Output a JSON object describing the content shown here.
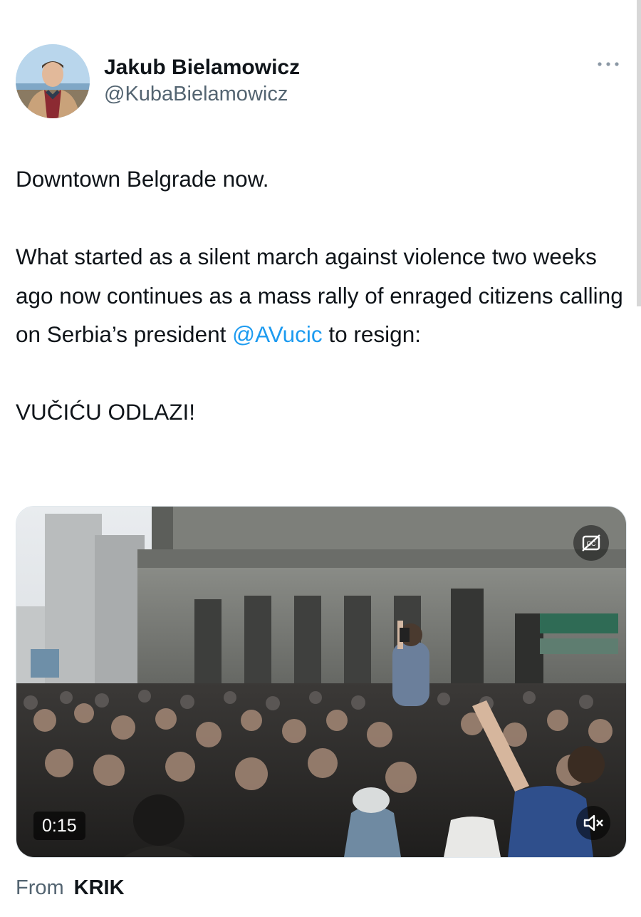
{
  "author": {
    "display_name": "Jakub Bielamowicz",
    "handle": "@KubaBielamowicz",
    "avatar_icon": "person-photo-avatar"
  },
  "more_menu": {
    "icon": "more-horizontal-icon"
  },
  "tweet": {
    "line1": "Downtown Belgrade now.",
    "line2": "What started as a silent march against violence two weeks ago now continues as a mass rally of enraged citizens calling on Serbia’s president ",
    "mention": "@AVucic",
    "line2_end": " to resign:",
    "line3": "VUČIĆU ODLAZI!",
    "mention_color": "#1d9bf0"
  },
  "video": {
    "duration": "0:15",
    "mute_icon": "speaker-muted-icon",
    "captions_icon": "closed-captions-off-icon"
  },
  "source": {
    "from_label": "From",
    "name": "KRIK"
  },
  "colors": {
    "text": "#0f1419",
    "secondary": "#536471",
    "link": "#1d9bf0"
  }
}
